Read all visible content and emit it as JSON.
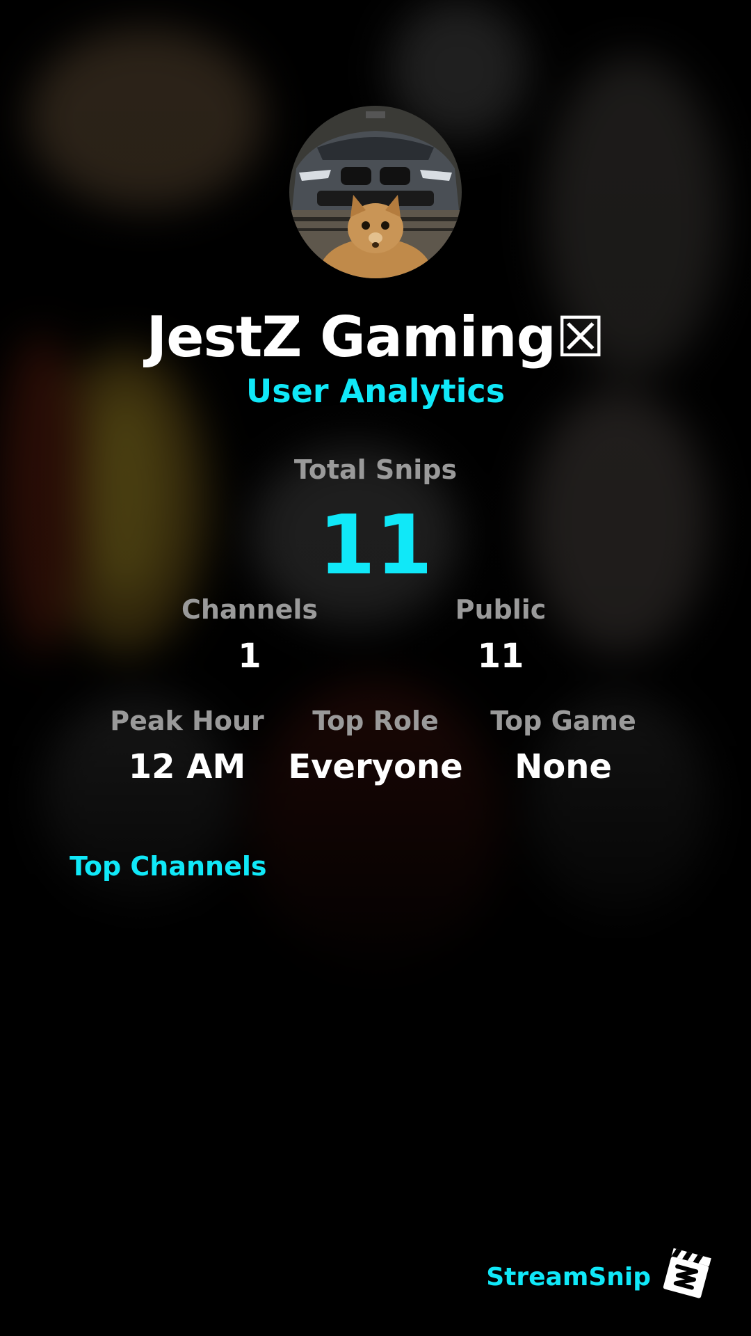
{
  "profile": {
    "username": "JestZ Gaming☒",
    "subtitle": "User Analytics"
  },
  "stats": {
    "total_snips_label": "Total Snips",
    "total_snips_value": "11",
    "channels_label": "Channels",
    "channels_value": "1",
    "public_label": "Public",
    "public_value": "11",
    "peak_hour_label": "Peak Hour",
    "peak_hour_value": "12 AM",
    "top_role_label": "Top Role",
    "top_role_value": "Everyone",
    "top_game_label": "Top Game",
    "top_game_value": "None"
  },
  "sections": {
    "top_channels_title": "Top Channels"
  },
  "brand": {
    "name": "StreamSnip",
    "logo_icon": "clapperboard-logo-icon"
  },
  "colors": {
    "accent": "#10e8f8",
    "label_gray": "#9a9a9a",
    "background": "#000000",
    "text": "#ffffff"
  }
}
